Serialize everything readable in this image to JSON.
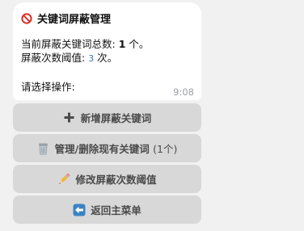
{
  "message": {
    "title": "关键词屏蔽管理",
    "total_label": "当前屏蔽关键词总数: ",
    "total_value": "1",
    "total_suffix": " 个。",
    "threshold_label": "屏蔽次数阈值: ",
    "threshold_value": "3",
    "threshold_suffix": " 次。",
    "prompt": "请选择操作:",
    "time": "9:08"
  },
  "buttons": {
    "add_label": "新增屏蔽关键词",
    "manage_label": "管理/删除现有关键词",
    "manage_count": "(1个)",
    "threshold_label": "修改屏蔽次数阈值",
    "back_label": "返回主菜单"
  },
  "icons": {
    "title": "prohibited-icon",
    "add": "plus-icon",
    "manage": "wastebasket-icon",
    "threshold": "pencil-icon",
    "back": "left-arrow-icon"
  },
  "colors": {
    "prohibited": "#d93025",
    "threshold_value": "#3a74b8",
    "button_bg": "#d8d8d8",
    "back_icon_bg": "#3b82c4"
  }
}
